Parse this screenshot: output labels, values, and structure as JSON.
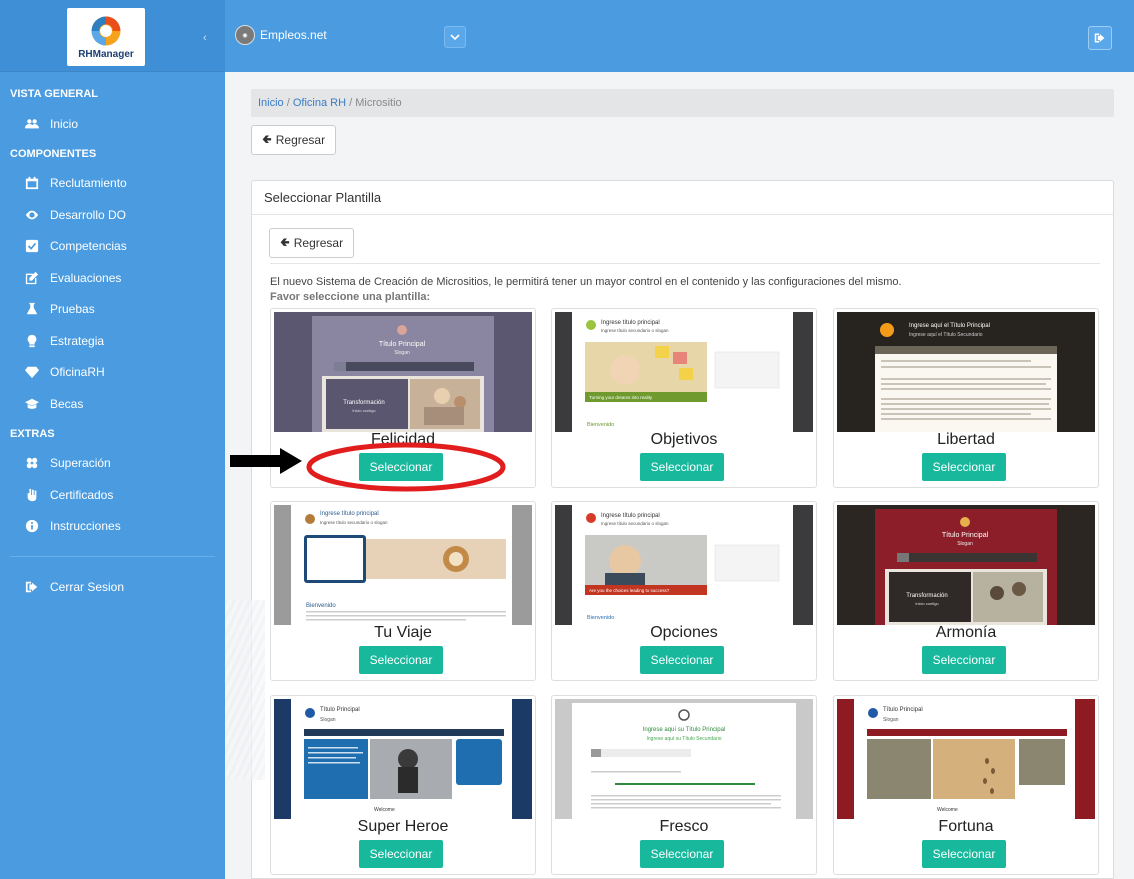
{
  "sidebar": {
    "logo_text": "RHManager",
    "sections": [
      {
        "title": "VISTA GENERAL"
      },
      {
        "title": "COMPONENTES"
      },
      {
        "title": "EXTRAS"
      }
    ],
    "items": [
      {
        "label": "Inicio",
        "icon": "users-icon"
      },
      {
        "label": "Reclutamiento",
        "icon": "calendar-icon"
      },
      {
        "label": "Desarrollo DO",
        "icon": "eye-icon"
      },
      {
        "label": "Competencias",
        "icon": "check-square-icon"
      },
      {
        "label": "Evaluaciones",
        "icon": "edit-icon"
      },
      {
        "label": "Pruebas",
        "icon": "flask-icon"
      },
      {
        "label": "Estrategia",
        "icon": "lightbulb-icon"
      },
      {
        "label": "OficinaRH",
        "icon": "diamond-icon"
      },
      {
        "label": "Becas",
        "icon": "graduation-cap-icon"
      },
      {
        "label": "Superación",
        "icon": "puzzle-icon"
      },
      {
        "label": "Certificados",
        "icon": "hand-icon"
      },
      {
        "label": "Instrucciones",
        "icon": "info-icon"
      },
      {
        "label": "Cerrar Sesion",
        "icon": "sign-out-icon"
      }
    ]
  },
  "topbar": {
    "brand": "Empleos.net"
  },
  "breadcrumb": {
    "home": "Inicio",
    "section": "Oficina RH",
    "current": "Micrositio",
    "sep": " / "
  },
  "buttons": {
    "back": "Regresar",
    "select": "Seleccionar"
  },
  "panel": {
    "title": "Seleccionar Plantilla",
    "intro": "El nuevo Sistema de Creación de Micrositios, le permitirá tener un mayor control en el contenido y las configuraciones del mismo.",
    "prompt": "Favor seleccione una plantilla:"
  },
  "templates": [
    {
      "name": "Felicidad"
    },
    {
      "name": "Objetivos"
    },
    {
      "name": "Libertad"
    },
    {
      "name": "Tu Viaje"
    },
    {
      "name": "Opciones"
    },
    {
      "name": "Armonía"
    },
    {
      "name": "Super Heroe"
    },
    {
      "name": "Fresco"
    },
    {
      "name": "Fortuna"
    }
  ],
  "thumb_text": {
    "felicidad": {
      "title": "Título Principal",
      "slogan": "Slogan",
      "hero": "Transformación",
      "hero_sub": "Inicio contigo"
    },
    "objetivos": {
      "title": "Ingrese título principal",
      "sub": "Ingrese título secundario o slogan",
      "banner": "Turning your dreams into reality",
      "welcome": "Bienvenido"
    },
    "libertad": {
      "title": "Ingrese aquí el Título Principal",
      "sub": "Ingrese aquí el Título Secundario"
    },
    "tuviaje": {
      "title": "Ingrese título principal",
      "sub": "Ingrese título secundario o slogan",
      "welcome": "Bienvenido"
    },
    "opciones": {
      "title": "Ingrese título principal",
      "sub": "Ingrese título secundario o slogan",
      "banner": "Are you the choices leading to success?",
      "welcome": "Bienvenido"
    },
    "armonia": {
      "title": "Título Principal",
      "slogan": "Slogan",
      "hero": "Transformación",
      "hero_sub": "Inicio contigo"
    },
    "superheroe": {
      "title": "Título Principal",
      "slogan": "Slogan",
      "welcome": "Welcome"
    },
    "fresco": {
      "title": "Ingrese aquí su Título Principal",
      "sub": "Ingrese aquí su Título Secundario"
    },
    "fortuna": {
      "title": "Título Principal",
      "slogan": "Slogan",
      "welcome": "Welcome"
    }
  },
  "colors": {
    "sidebar": "#4a9be0",
    "accent_button": "#17b89c",
    "annotation_ellipse": "#e11d1d",
    "annotation_arrow": "#000000"
  }
}
